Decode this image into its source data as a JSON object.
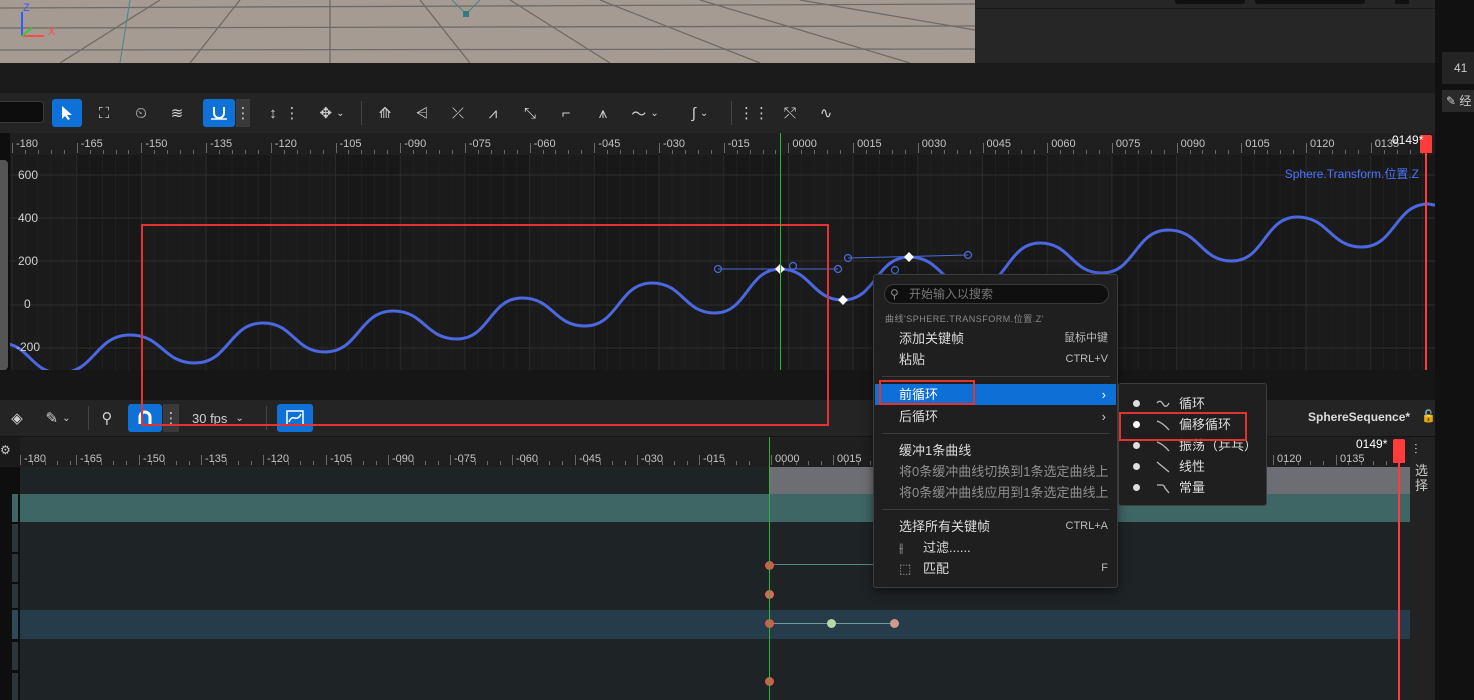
{
  "axis_gizmo": {
    "z": "Z",
    "x": "X"
  },
  "right_strip": {
    "number": "41",
    "edit_label": "经"
  },
  "curve_editor": {
    "ruler_ticks": [
      "-180",
      "-165",
      "-150",
      "-135",
      "-120",
      "-105",
      "-090",
      "-075",
      "-060",
      "-045",
      "-030",
      "-015",
      "0000",
      "0015",
      "0030",
      "0045",
      "0060",
      "0075",
      "0090",
      "0105",
      "0120",
      "0135"
    ],
    "playhead_label": "0149*",
    "y_axis_labels": [
      "600",
      "400",
      "200",
      "0",
      "-200"
    ],
    "curve_name": "Sphere.Transform.位置.Z",
    "colors": {
      "curve": "#4b68e0",
      "highlight": "#0e71d8",
      "playhead": "#ff3b3b"
    }
  },
  "sequencer": {
    "fps_label": "30 fps",
    "sequence_name": "SphereSequence*",
    "ruler_ticks": [
      "-180",
      "-165",
      "-150",
      "-135",
      "-120",
      "-105",
      "-090",
      "-075",
      "-060",
      "-045",
      "-030",
      "-015",
      "0000",
      "0015",
      "0120",
      "0135"
    ],
    "playhead_label": "0149*",
    "side_tab": "选择"
  },
  "context_menu": {
    "search_placeholder": "开始输入以搜索",
    "header": "曲线'SPHERE.TRANSFORM.位置.Z'",
    "add_key": {
      "label": "添加关键帧",
      "shortcut": "鼠标中键"
    },
    "paste": {
      "label": "粘贴",
      "shortcut": "CTRL+V"
    },
    "pre_infinity": "前循环",
    "post_infinity": "后循环",
    "buffer_curve": "缓冲1条曲线",
    "swap_buffer": "将0条缓冲曲线切换到1条选定曲线上",
    "apply_buffer": "将0条缓冲曲线应用到1条选定曲线上",
    "select_all": {
      "label": "选择所有关键帧",
      "shortcut": "CTRL+A"
    },
    "filter": "过滤......",
    "match": {
      "label": "匹配",
      "shortcut": "F"
    }
  },
  "submenu": {
    "items": [
      "循环",
      "偏移循环",
      "振荡（乒乓）",
      "线性",
      "常量"
    ],
    "selected_index": 1
  }
}
